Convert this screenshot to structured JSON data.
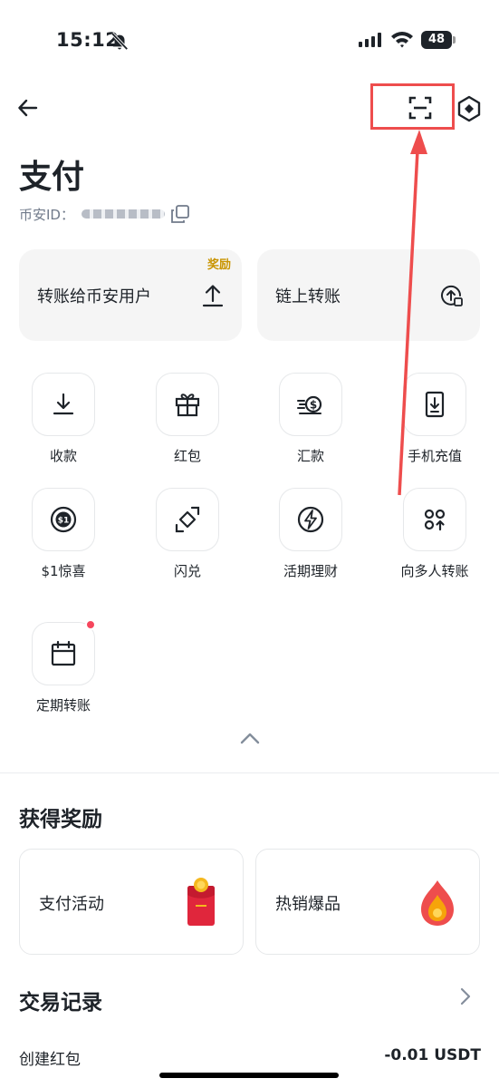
{
  "status_bar": {
    "time": "15:12",
    "battery": "48",
    "icons": [
      "bell-off-icon",
      "signal-icon",
      "wifi-icon",
      "battery-icon"
    ]
  },
  "nav": {
    "icons": [
      "arrow-left-icon",
      "scan-icon",
      "settings-hex-icon"
    ]
  },
  "header": {
    "title": "支付",
    "uid_label": "币安ID："
  },
  "transfer_cards": [
    {
      "label": "转账给币安用户",
      "badge": "奖励",
      "icon": "upload-icon"
    },
    {
      "label": "链上转账",
      "icon": "chain-transfer-icon"
    }
  ],
  "features": [
    {
      "label": "收款",
      "icon": "download-icon"
    },
    {
      "label": "红包",
      "icon": "gift-icon"
    },
    {
      "label": "汇款",
      "icon": "remittance-icon"
    },
    {
      "label": "手机充值",
      "icon": "phone-topup-icon"
    },
    {
      "label": "$1惊喜",
      "icon": "dollar-coin-icon"
    },
    {
      "label": "闪兑",
      "icon": "convert-icon"
    },
    {
      "label": "活期理财",
      "icon": "lightning-icon"
    },
    {
      "label": "向多人转账",
      "icon": "multi-transfer-icon"
    },
    {
      "label": "定期转账",
      "icon": "calendar-icon",
      "has_dot": true
    }
  ],
  "rewards": {
    "title": "获得奖励",
    "cards": [
      {
        "label": "支付活动",
        "icon": "red-envelope-icon"
      },
      {
        "label": "热销爆品",
        "icon": "fire-icon"
      }
    ]
  },
  "transactions": {
    "title": "交易记录",
    "items": [
      {
        "name": "创建红包",
        "amount": "-0.01 USDT"
      }
    ]
  },
  "colors": {
    "accent_yellow": "#c99400",
    "highlight_red": "#ee4d4d",
    "card_bg": "#f5f5f5",
    "text_primary": "#1e2329",
    "text_secondary": "#707a8a",
    "dot_red": "#f6465d"
  }
}
